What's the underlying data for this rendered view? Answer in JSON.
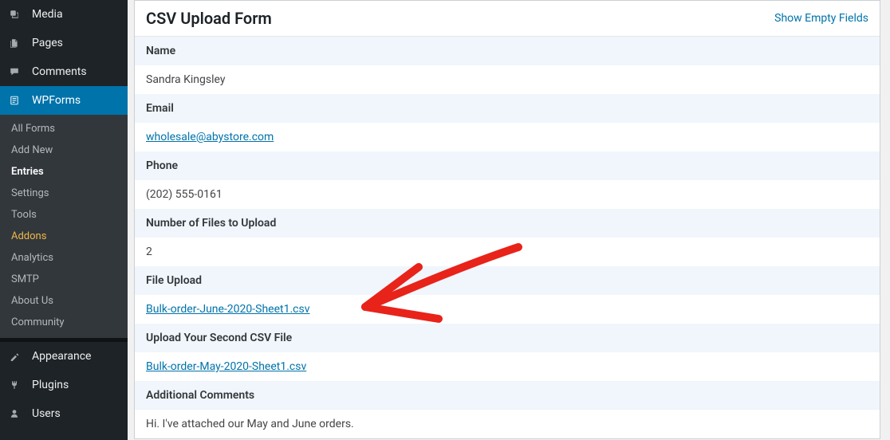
{
  "sidebar": {
    "primary": [
      {
        "id": "media",
        "label": "Media",
        "icon": "media"
      },
      {
        "id": "pages",
        "label": "Pages",
        "icon": "pages"
      },
      {
        "id": "comments",
        "label": "Comments",
        "icon": "comments"
      },
      {
        "id": "wpforms",
        "label": "WPForms",
        "icon": "wpforms",
        "active": true
      }
    ],
    "wpforms_sub": [
      {
        "id": "all-forms",
        "label": "All Forms"
      },
      {
        "id": "add-new",
        "label": "Add New"
      },
      {
        "id": "entries",
        "label": "Entries",
        "current": true
      },
      {
        "id": "settings",
        "label": "Settings"
      },
      {
        "id": "tools",
        "label": "Tools"
      },
      {
        "id": "addons",
        "label": "Addons",
        "highlight": true
      },
      {
        "id": "analytics",
        "label": "Analytics"
      },
      {
        "id": "smtp",
        "label": "SMTP"
      },
      {
        "id": "about",
        "label": "About Us"
      },
      {
        "id": "community",
        "label": "Community"
      }
    ],
    "bottom": [
      {
        "id": "appearance",
        "label": "Appearance",
        "icon": "appearance"
      },
      {
        "id": "plugins",
        "label": "Plugins",
        "icon": "plugins"
      },
      {
        "id": "users",
        "label": "Users",
        "icon": "users"
      }
    ]
  },
  "panel": {
    "title": "CSV Upload Form",
    "show_empty": "Show Empty Fields",
    "fields": [
      {
        "label": "Name",
        "value": "Sandra Kingsley",
        "type": "text"
      },
      {
        "label": "Email",
        "value": "wholesale@abystore.com",
        "type": "link"
      },
      {
        "label": "Phone",
        "value": "(202) 555-0161",
        "type": "text"
      },
      {
        "label": "Number of Files to Upload",
        "value": "2",
        "type": "text"
      },
      {
        "label": "File Upload",
        "value": "Bulk-order-June-2020-Sheet1.csv",
        "type": "link"
      },
      {
        "label": "Upload Your Second CSV File",
        "value": "Bulk-order-May-2020-Sheet1.csv",
        "type": "link"
      },
      {
        "label": "Additional Comments",
        "value": "Hi. I've attached our May and June orders.",
        "type": "text"
      }
    ]
  }
}
